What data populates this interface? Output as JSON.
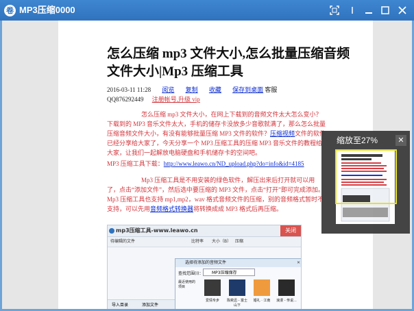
{
  "window": {
    "title": "MP3压缩0000",
    "app_icon_glyph": "卷",
    "buttons": [
      "fit-icon",
      "pin-icon",
      "minimize-icon",
      "maximize-icon",
      "close-icon"
    ]
  },
  "document": {
    "title": "怎么压缩 mp3 文件大小,怎么批量压缩音频文件大小|Mp3 压缩工具",
    "meta_date": "2016-03-11 11:28",
    "meta_links": [
      "阅览",
      "复制",
      "收藏",
      "保存到桌面"
    ],
    "meta_suffix": "客服",
    "meta_qq": "QQ876292449",
    "meta_register": "注册帐号,升级 vip",
    "para1_a": "怎么压缩 mp3 文件大小，在网上下载到的音频文件太大怎么变小？下载到的 MP3 音乐文件太大，手机的储存卡没放多少音歌就满了，那么怎么批量压缩音频文件大小，有没有能够批量压缩 MP3 文件的软件？",
    "para1_link": "压缩视频",
    "para1_b": "文件的软件已经分享给大家了，今天分享一个 MP3 压缩工具的压缩 MP3 音乐文件的教程给大家，让我们一起解放电脑硬盘和手机储存卡的空间吧。",
    "para2_label": "MP3 压缩工具下载：",
    "para2_link": "http://www.leawo.cn/ND_upload.php?do=info&id=4185",
    "para3_a": "Mp3 压缩工具是不用安装的绿色软件，解压出来后打开就可以用了，点击“添加文件”，然后选中要压缩的 MP3 文件，点击“打开”即可完成添加。Mp3 压缩工具也支持 mp1,mp2，wav 格式音频文件的压缩，别的音频格式暂时不支持，可以先用",
    "para3_link": "音频格式转换器",
    "para3_b": "将转换成成 MP3 格式后再压缩。"
  },
  "embedded": {
    "app_title": "mp3压缩工具-www.leawo.cn",
    "col1": "待编辑的文件",
    "col2": "比特率",
    "col3": "大小（B）",
    "col4": "压缩",
    "close_label": "关闭",
    "dialog_title": "选择待添加的音频文件",
    "lookin_label": "查找范围(I)：",
    "lookin_value": "MP3压缩保存",
    "recent_label": "最近使用的项目",
    "files": [
      "爱情专步",
      "陈奕迅 - 富士山下",
      "婚礼 · 江南",
      "浪漫 - 传说..."
    ],
    "bottom_add": "导入目录",
    "bottom_add2": "添加文件"
  },
  "zoom": {
    "label": "缩放至27%",
    "close_glyph": "✕"
  },
  "colors": {
    "titlebar": "#3f86d1",
    "link": "#0b2bd0",
    "red_text": "#d3343b",
    "zoom_frame": "#e8e021"
  }
}
